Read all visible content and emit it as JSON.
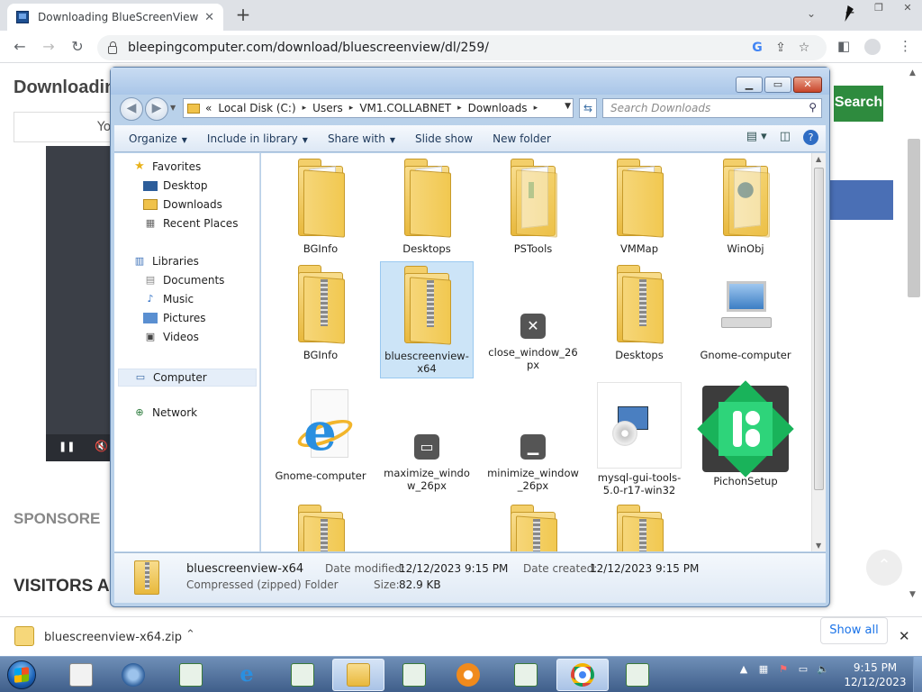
{
  "browser": {
    "tab_title": "Downloading BlueScreenView",
    "url": "bleepingcomputer.com/download/bluescreenview/dl/259/"
  },
  "page": {
    "heading": "Downloadin",
    "you_label": "Yo",
    "search_button": "Search",
    "sponsored": "SPONSORE",
    "visitors": "VISITORS A"
  },
  "download_shelf": {
    "file_name": "bluescreenview-x64.zip",
    "show_all": "Show all"
  },
  "explorer": {
    "address": [
      "«",
      "Local Disk (C:)",
      "Users",
      "VM1.COLLABNET",
      "Downloads"
    ],
    "search_placeholder": "Search Downloads",
    "commands": [
      "Organize",
      "Include in library",
      "Share with",
      "Slide show",
      "New folder"
    ],
    "nav": {
      "favorites": "Favorites",
      "desktop": "Desktop",
      "downloads": "Downloads",
      "recent": "Recent Places",
      "libraries": "Libraries",
      "documents": "Documents",
      "music": "Music",
      "pictures": "Pictures",
      "videos": "Videos",
      "computer": "Computer",
      "network": "Network"
    },
    "files": [
      {
        "name": "BGInfo",
        "icon": "folder-icon"
      },
      {
        "name": "Desktops",
        "icon": "folder-icon"
      },
      {
        "name": "PSTools",
        "icon": "folder-icon"
      },
      {
        "name": "VMMap",
        "icon": "folder-icon"
      },
      {
        "name": "WinObj",
        "icon": "folder-icon"
      },
      {
        "name": "BGInfo",
        "icon": "zip-folder-icon"
      },
      {
        "name": "bluescreenview-x64",
        "icon": "zip-folder-icon"
      },
      {
        "name": "close_window_26px",
        "icon": "close-window-icon"
      },
      {
        "name": "Desktops",
        "icon": "zip-folder-icon"
      },
      {
        "name": "Gnome-computer",
        "icon": "computer-icon"
      },
      {
        "name": "Gnome-computer",
        "icon": "internet-explorer-icon"
      },
      {
        "name": "maximize_window_26px",
        "icon": "maximize-window-icon"
      },
      {
        "name": "minimize_window_26px",
        "icon": "minimize-window-icon"
      },
      {
        "name": "mysql-gui-tools-5.0-r17-win32",
        "icon": "installer-icon"
      },
      {
        "name": "PichonSetup",
        "icon": "pichon-icon"
      }
    ],
    "details": {
      "name": "bluescreenview-x64",
      "type": "Compressed (zipped) Folder",
      "modified_label": "Date modified:",
      "modified": "12/12/2023 9:15 PM",
      "created_label": "Date created:",
      "created": "12/12/2023 9:15 PM",
      "size_label": "Size:",
      "size": "82.9 KB"
    }
  },
  "taskbar": {
    "time": "9:15 PM",
    "date": "12/12/2023"
  },
  "colors": {
    "chrome_tabstrip": "#dee1e6",
    "explorer_frame": "#b9d1ea",
    "selection": "#cce4f7",
    "taskbar": "#3f5e8a",
    "search_button": "#2e8b3e"
  }
}
